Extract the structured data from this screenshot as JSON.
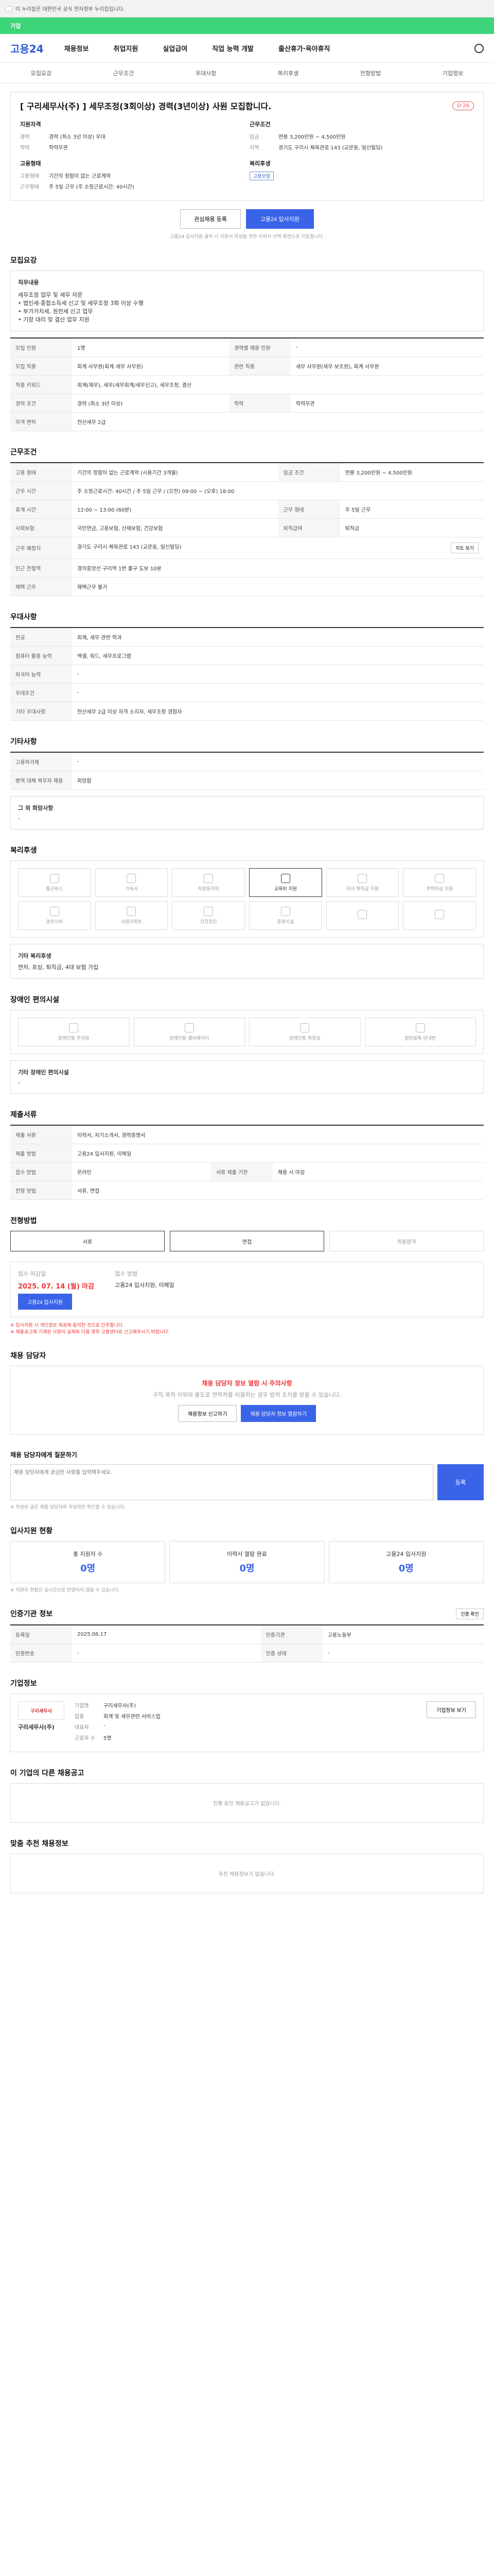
{
  "gov_notice": "이 누리집은 대한민국 공식 전자정부 누리집입니다.",
  "accent_label": "기업",
  "logo": "고용24",
  "gnb": [
    "채용정보",
    "취업지원",
    "실업급여",
    "직업 능력 개발",
    "출산휴가·육아휴직"
  ],
  "subnav": [
    "모집요강",
    "근무조건",
    "우대사항",
    "복리후생",
    "전형방법",
    "기업정보"
  ],
  "job": {
    "title": "[ 구리세무사(주) ] 세무조정(3회이상) 경력(3년이상) 사원 모집합니다.",
    "dday": "D-26",
    "col1_title": "지원자격",
    "col1": [
      {
        "k": "경력",
        "v": "경력 (최소 3년 이상) 우대"
      },
      {
        "k": "학력",
        "v": "학력무관"
      }
    ],
    "col2_title": "근무조건",
    "col2": [
      {
        "k": "임금",
        "v": "연봉 3,200만원 ~ 4,500만원"
      },
      {
        "k": "지역",
        "v": "경기도 구리시 체육관로 143 (교문동, 일신빌딩)"
      }
    ],
    "col3_title": "고용형태",
    "col3": [
      {
        "k": "고용형태",
        "v": "기간의 정함이 없는 근로계약"
      },
      {
        "k": "근무형태",
        "v": "주 5일 근무 (주 소정근로시간: 40시간)"
      }
    ],
    "col4_title": "복리후생",
    "col4_tag": "고용보험",
    "btn_interest": "관심채용 등록",
    "btn_apply": "고용24 입사지원",
    "note": "고용24 입사지원 클릭 시 지원서 작성을 위한 이력서 선택 화면으로 이동합니다."
  },
  "recruit": {
    "section": "모집요강",
    "duty_title": "직무내용",
    "duty": [
      "세무조정 업무 및 세무 자문",
      "• 법인세·종합소득세 신고 및 세무조정 3회 이상 수행",
      "• 부가가치세, 원천세 신고 업무",
      "• 기장 대리 및 결산 업무 지원"
    ],
    "rows": [
      {
        "k": "모집 인원",
        "v": "1명",
        "k2": "경력별 채용 인원",
        "v2": "-"
      },
      {
        "k": "모집 직종",
        "v": "회계 사무원(회계 세무 사무원)",
        "k2": "관련 직종",
        "v2": "세무 사무원(세무 보조원), 회계 사무원"
      },
      {
        "k": "직종 키워드",
        "v": "회계(재무), 세무(세무회계/세무신고), 세무조정, 결산",
        "k2": "",
        "v2": ""
      },
      {
        "k": "경력 조건",
        "v": "경력 (최소 3년 이상)",
        "k2": "학력",
        "v2": "학력무관"
      },
      {
        "k": "자격 면허",
        "v": "전산세무 2급",
        "k2": "",
        "v2": ""
      }
    ]
  },
  "work": {
    "section": "근무조건",
    "rows": [
      {
        "k": "고용 형태",
        "v": "기간의 정함이 없는 근로계약 (시용기간 3개월)",
        "k2": "임금 조건",
        "v2": "연봉 3,200만원 ~ 4,500만원"
      },
      {
        "k": "근무 시간",
        "v": "주 소정근로시간: 40시간 / 주 5일 근무 / (오전) 09:00 ~ (오후) 18:00",
        "k2": "",
        "v2": ""
      },
      {
        "k": "휴게 시간",
        "v": "12:00 ~ 13:00 (60분)",
        "k2": "근무 형태",
        "v2": "주 5일 근무"
      },
      {
        "k": "사회보험",
        "v": "국민연금, 고용보험, 산재보험, 건강보험",
        "k2": "퇴직급여",
        "v2": "퇴직금"
      },
      {
        "k": "근무 예정지",
        "v": "경기도 구리시 체육관로 143 (교문동, 일신빌딩)",
        "k2": "",
        "v2": ""
      },
      {
        "k": "인근 전철역",
        "v": "경의중앙선 구리역 1번 출구 도보 10분",
        "k2": "",
        "v2": ""
      },
      {
        "k": "재택 근무",
        "v": "재택근무 불가",
        "k2": "",
        "v2": ""
      }
    ],
    "map_button": "지도 보기"
  },
  "prefer": {
    "section": "우대사항",
    "rows": [
      {
        "k": "전공",
        "v": "회계, 세무 관련 학과"
      },
      {
        "k": "컴퓨터 활용 능력",
        "v": "엑셀, 워드, 세무프로그램"
      },
      {
        "k": "외국어 능력",
        "v": "-"
      },
      {
        "k": "우대조건",
        "v": "-"
      },
      {
        "k": "기타 우대사항",
        "v": "전산세무 2급 이상 자격 소지자, 세무조정 경험자"
      }
    ]
  },
  "other": {
    "section": "기타사항",
    "rows": [
      {
        "k": "고용허가제",
        "v": "-"
      },
      {
        "k": "병역 대체 복무자 채용",
        "v": "희망함"
      }
    ],
    "extra_title": "그 외 희망사항",
    "extra": "-"
  },
  "welfare": {
    "section": "복리후생",
    "icons": [
      "통근버스",
      "기숙사",
      "차량유지비",
      "교육비 지원",
      "자녀 학자금 지원",
      "주택자금 지원",
      "경조사비",
      "사원아파트",
      "건강검진",
      "휴양시설",
      "",
      ""
    ],
    "active_index": 3,
    "etc_title": "기타 복리후생",
    "etc": "연차, 포상, 퇴직금, 4대 보험 가입"
  },
  "disability": {
    "section": "장애인 편의시설",
    "icons": [
      "장애인용 주차장",
      "장애인용 엘리베이터",
      "장애인용 화장실",
      "점자블록·안내판"
    ],
    "etc_title": "기타 장애인 편의시설",
    "etc": "-"
  },
  "docs": {
    "section": "제출서류",
    "rows": [
      {
        "k": "제출 서류",
        "v": "이력서, 자기소개서, 경력증명서",
        "k2": "",
        "v2": ""
      },
      {
        "k": "제출 방법",
        "v": "고용24 입사지원, 이메일",
        "k2": "",
        "v2": ""
      },
      {
        "k": "접수 방법",
        "v": "온라인",
        "k2": "서류 제출 기한",
        "v2": "채용 시 마감"
      },
      {
        "k": "전형 방법",
        "v": "서류, 면접",
        "k2": "",
        "v2": ""
      }
    ]
  },
  "process": {
    "section": "전형방법",
    "steps": [
      "서류",
      "면접",
      "최종합격"
    ]
  },
  "apply": {
    "deadline_label": "접수 마감일",
    "deadline": "2025. 07. 14 (월) 마감",
    "method_label": "접수 방법",
    "method": "고용24 입사지원, 이메일",
    "btn": "고용24 입사지원",
    "notes": [
      "※ 입사지원 시 개인정보 제공에 동의한 것으로 간주합니다.",
      "※ 채용공고에 기재된 사항이 실제와 다를 경우 고용센터로 신고해주시기 바랍니다."
    ]
  },
  "contact": {
    "section": "채용 담당자",
    "alert": "채용 담당자 정보 열람 시 주의사항",
    "text": "구직 목적 이외의 용도로 연락처를 이용하는 경우 법적 조치를 받을 수 있습니다.",
    "btn1": "채용정보 신고하기",
    "btn2": "채용 담당자 정보 열람하기"
  },
  "qna": {
    "section": "채용 담당자에게 질문하기",
    "placeholder": "채용 담당자에게 궁금한 사항을 입력해주세요.",
    "submit": "등록",
    "note": "※ 작성된 글은 채용 담당자와 작성자만 확인할 수 있습니다."
  },
  "status": {
    "section": "입사지원 현황",
    "counters": [
      {
        "label": "총 지원자 수",
        "value": "0명"
      },
      {
        "label": "이력서 열람 완료",
        "value": "0명"
      },
      {
        "label": "고용24 입사지원",
        "value": "0명"
      }
    ],
    "note": "※ 지원자 현황은 실시간으로 반영되지 않을 수 있습니다."
  },
  "agency": {
    "section": "인증기관 정보",
    "btn": "인증 확인",
    "rows": [
      {
        "k": "등록일",
        "v": "2025.06.17",
        "k2": "인증기관",
        "v2": "고용노동부"
      },
      {
        "k": "인증번호",
        "v": "-",
        "k2": "인증 상태",
        "v2": "-"
      }
    ]
  },
  "company": {
    "section": "기업정보",
    "logo_text": "구리세무사",
    "name": "구리세무사(주)",
    "btn_more": "기업정보 보기",
    "rows": [
      {
        "k": "기업명",
        "v": "구리세무사(주)"
      },
      {
        "k": "업종",
        "v": "회계 및 세무관련 서비스업"
      },
      {
        "k": "대표자",
        "v": "-"
      },
      {
        "k": "근로자 수",
        "v": "5명"
      }
    ]
  },
  "related": {
    "section": "이 기업의 다른 채용공고",
    "empty": "진행 중인 채용공고가 없습니다."
  },
  "recommend": {
    "section": "맞춤 추천 채용정보",
    "empty": "추천 채용정보가 없습니다."
  }
}
